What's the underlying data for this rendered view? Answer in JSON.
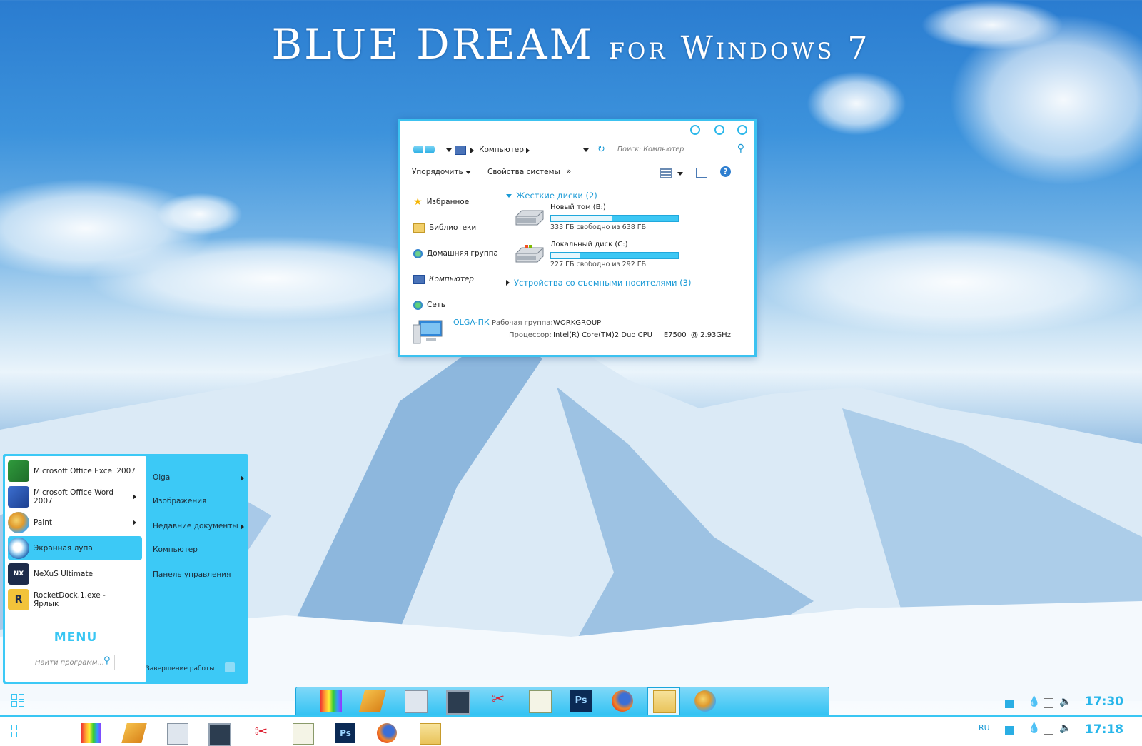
{
  "wallpaper_title": {
    "main": "BLUE DREAM",
    "suffix": "for Windows 7"
  },
  "explorer": {
    "breadcrumb": "Компьютер",
    "search_placeholder": "Поиск: Компьютер",
    "toolbar": {
      "organize": "Упорядочить",
      "system_properties": "Свойства системы",
      "more": "»"
    },
    "nav_items": [
      {
        "label": "Избранное",
        "icon": "star-icon"
      },
      {
        "label": "Библиотеки",
        "icon": "libraries-icon"
      },
      {
        "label": "Домашняя группа",
        "icon": "homegroup-icon"
      },
      {
        "label": "Компьютер",
        "icon": "computer-icon"
      },
      {
        "label": "Сеть",
        "icon": "network-icon"
      }
    ],
    "group_hard_disks": "Жесткие диски (2)",
    "drives": [
      {
        "name": "Новый том (B:)",
        "free_text": "333 ГБ свободно из 638 ГБ",
        "used_fraction": 0.478
      },
      {
        "name": "Локальный диск (C:)",
        "free_text": "227 ГБ свободно из 292 ГБ",
        "used_fraction": 0.223
      }
    ],
    "group_removable": "Устройства со съемными носителями (3)",
    "footer": {
      "pc_name": "OLGA-ПК",
      "workgroup_label": "Рабочая группа:",
      "workgroup_value": "WORKGROUP",
      "cpu_label": "Процессор:",
      "cpu_value": "Intel(R) Core(TM)2 Duo CPU     E7500  @ 2.93GHz"
    }
  },
  "start_menu": {
    "programs": [
      {
        "label": "Microsoft Office Excel 2007",
        "icon": "excel-icon",
        "has_arrow": false
      },
      {
        "label": "Microsoft Office Word 2007",
        "icon": "word-icon",
        "has_arrow": true
      },
      {
        "label": "Paint",
        "icon": "paint-icon",
        "has_arrow": true
      },
      {
        "label": "Экранная лупа",
        "icon": "magnifier-icon",
        "has_arrow": false,
        "selected": true
      },
      {
        "label": "NeXuS Ultimate",
        "icon": "nexus-icon",
        "has_arrow": false
      },
      {
        "label": "RocketDock,1.exe - Ярлык",
        "icon": "rocketdock-icon",
        "has_arrow": false
      }
    ],
    "menu_word": "MENU",
    "search_placeholder": "Найти программ...",
    "right_items": [
      {
        "label": "Olga",
        "has_arrow": true
      },
      {
        "label": "Изображения",
        "has_arrow": false
      },
      {
        "label": "Недавние документы",
        "has_arrow": true
      },
      {
        "label": "Компьютер",
        "has_arrow": false
      },
      {
        "label": "Панель управления",
        "has_arrow": false
      }
    ],
    "shutdown": "Завершение работы"
  },
  "dock_icons": [
    "colorbars-icon",
    "winamp-icon",
    "calculator-icon",
    "monitor-icon",
    "scissors-icon",
    "notepad-chart-icon",
    "photoshop-icon",
    "firefox-icon",
    "explorer-folder-icon",
    "paint-icon"
  ],
  "taskbar_icons": [
    "colorbars-icon",
    "winamp-icon",
    "calculator-icon",
    "monitor-icon",
    "scissors-icon",
    "notepad-chart-icon",
    "photoshop-icon",
    "firefox-icon",
    "explorer-folder-icon"
  ],
  "upper_clock": "17:30",
  "lower_clock": "17:18",
  "language": "RU",
  "colors": {
    "accent": "#39c6f3",
    "accent_dark": "#1a9ad6"
  }
}
